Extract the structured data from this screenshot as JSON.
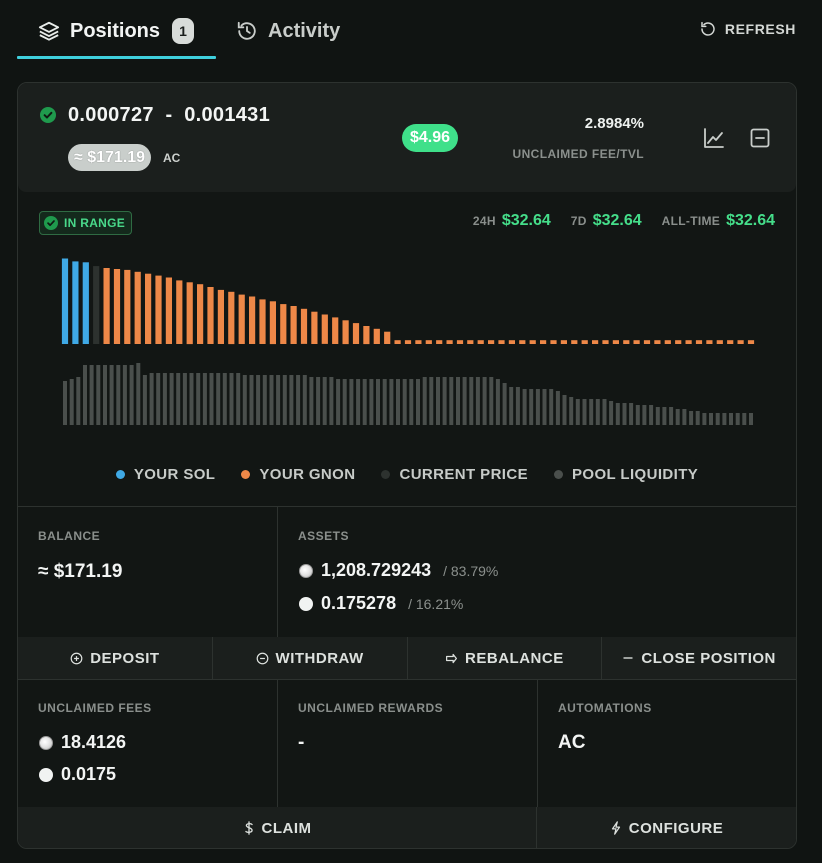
{
  "tabs": {
    "positions_label": "Positions",
    "positions_count": "1",
    "activity_label": "Activity",
    "refresh_label": "REFRESH"
  },
  "position": {
    "range": "0.000727  -  0.001431",
    "value": "≈ $171.19",
    "automation_tag": "AC",
    "unclaimed_fee_value": "$4.96",
    "fee_tvl_pct": "2.8984%",
    "fee_tvl_label": "UNCLAIMED FEE/TVL"
  },
  "status": {
    "range_label": "IN RANGE"
  },
  "stats": {
    "h24_label": "24H",
    "h24_value": "$32.64",
    "d7_label": "7D",
    "d7_value": "$32.64",
    "alltime_label": "ALL-TIME",
    "alltime_value": "$32.64"
  },
  "chart_data": {
    "type": "bar",
    "upper_series": {
      "sol_bins": 3,
      "current_bin": 1,
      "gnon_values": [
        80,
        79,
        78,
        76,
        74,
        72,
        70,
        67,
        65,
        63,
        60,
        57,
        55,
        52,
        50,
        47,
        45,
        42,
        40,
        37,
        34,
        31,
        28,
        25,
        22,
        19,
        16,
        13
      ],
      "sol_values": [
        90,
        87,
        86
      ],
      "current_value": 82,
      "flat_bins": 35,
      "flat_value": 4
    },
    "pool_liquidity": [
      44,
      46,
      48,
      60,
      60,
      60,
      60,
      60,
      60,
      60,
      60,
      62,
      50,
      52,
      52,
      52,
      52,
      52,
      52,
      52,
      52,
      52,
      52,
      52,
      52,
      52,
      52,
      50,
      50,
      50,
      50,
      50,
      50,
      50,
      50,
      50,
      50,
      48,
      48,
      48,
      48,
      46,
      46,
      46,
      46,
      46,
      46,
      46,
      46,
      46,
      46,
      46,
      46,
      46,
      48,
      48,
      48,
      48,
      48,
      48,
      48,
      48,
      48,
      48,
      48,
      46,
      42,
      38,
      38,
      36,
      36,
      36,
      36,
      36,
      34,
      30,
      28,
      26,
      26,
      26,
      26,
      26,
      24,
      22,
      22,
      22,
      20,
      20,
      20,
      18,
      18,
      18,
      16,
      16,
      14,
      14,
      12,
      12,
      12,
      12,
      12,
      12,
      12,
      12
    ],
    "colors": {
      "sol": "#3fa9e5",
      "gnon": "#ee8848",
      "current": "#2d322f",
      "pool": "#4a4f4c"
    },
    "legend": [
      "YOUR SOL",
      "YOUR GNON",
      "CURRENT PRICE",
      "POOL LIQUIDITY"
    ]
  },
  "legend": {
    "sol": "YOUR SOL",
    "gnon": "YOUR GNON",
    "current": "CURRENT PRICE",
    "pool": "POOL LIQUIDITY"
  },
  "balance": {
    "label": "BALANCE",
    "value": "≈ $171.19"
  },
  "assets": {
    "label": "ASSETS",
    "gnon_amount": "1,208.729243",
    "gnon_pct": "/ 83.79%",
    "sol_amount": "0.175278",
    "sol_pct": "/ 16.21%"
  },
  "actions": {
    "deposit": "DEPOSIT",
    "withdraw": "WITHDRAW",
    "rebalance": "REBALANCE",
    "close": "CLOSE POSITION"
  },
  "fees": {
    "label": "UNCLAIMED FEES",
    "gnon": "18.4126",
    "sol": "0.0175"
  },
  "rewards": {
    "label": "UNCLAIMED REWARDS",
    "value": "-"
  },
  "automations": {
    "label": "AUTOMATIONS",
    "value": "AC"
  },
  "bottom_actions": {
    "claim": "CLAIM",
    "configure": "CONFIGURE"
  },
  "colors": {
    "accent_cyan": "#3fd0dd",
    "green": "#45de8a",
    "orange": "#ee8848",
    "blue": "#3fa9e5"
  }
}
